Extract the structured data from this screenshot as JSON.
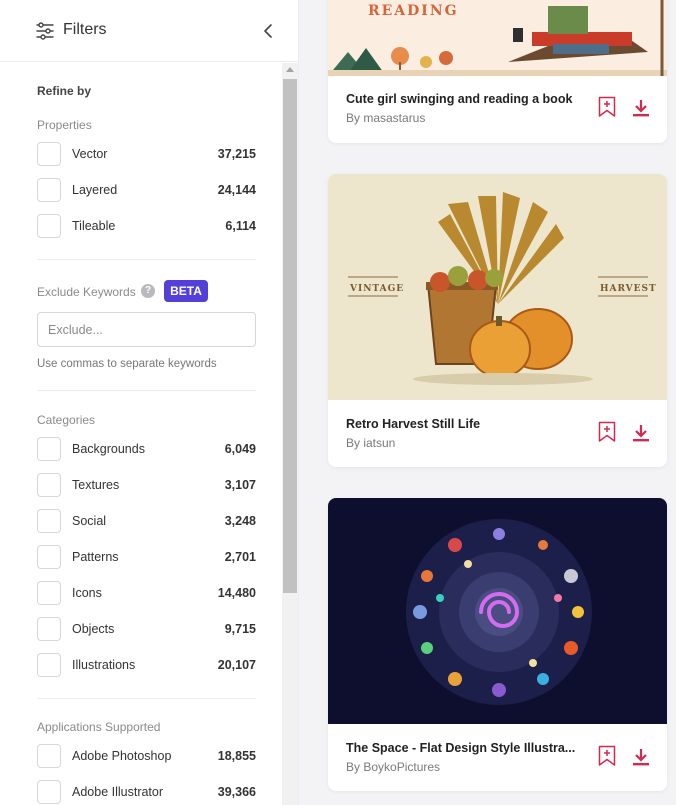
{
  "sidebar": {
    "header_title": "Filters",
    "refine_by": "Refine by",
    "properties": {
      "heading": "Properties",
      "items": [
        {
          "label": "Vector",
          "count": "37,215"
        },
        {
          "label": "Layered",
          "count": "24,144"
        },
        {
          "label": "Tileable",
          "count": "6,114"
        }
      ]
    },
    "exclude": {
      "heading": "Exclude Keywords",
      "help": "?",
      "badge": "BETA",
      "placeholder": "Exclude...",
      "hint": "Use commas to separate keywords"
    },
    "categories": {
      "heading": "Categories",
      "items": [
        {
          "label": "Backgrounds",
          "count": "6,049"
        },
        {
          "label": "Textures",
          "count": "3,107"
        },
        {
          "label": "Social",
          "count": "3,248"
        },
        {
          "label": "Patterns",
          "count": "2,701"
        },
        {
          "label": "Icons",
          "count": "14,480"
        },
        {
          "label": "Objects",
          "count": "9,715"
        },
        {
          "label": "Illustrations",
          "count": "20,107"
        }
      ]
    },
    "applications": {
      "heading": "Applications Supported",
      "items": [
        {
          "label": "Adobe Photoshop",
          "count": "18,855"
        },
        {
          "label": "Adobe Illustrator",
          "count": "39,366"
        }
      ]
    }
  },
  "cards": [
    {
      "title": "Cute girl swinging and reading a book",
      "author": "By masastarus",
      "image_text": "READING"
    },
    {
      "title": "Retro Harvest Still Life",
      "author": "By iatsun",
      "image_text_left": "VINTAGE",
      "image_text_right": "HARVEST"
    },
    {
      "title": "The Space - Flat Design Style Illustra...",
      "author": "By BoykoPictures"
    }
  ],
  "colors": {
    "accent_red": "#d5284f",
    "beta_purple": "#5240d8",
    "space_bg": "#0e0f2e"
  },
  "icons": [
    "filter-sliders-icon",
    "chevron-left-icon",
    "help-icon",
    "bookmark-add-icon",
    "download-icon"
  ]
}
